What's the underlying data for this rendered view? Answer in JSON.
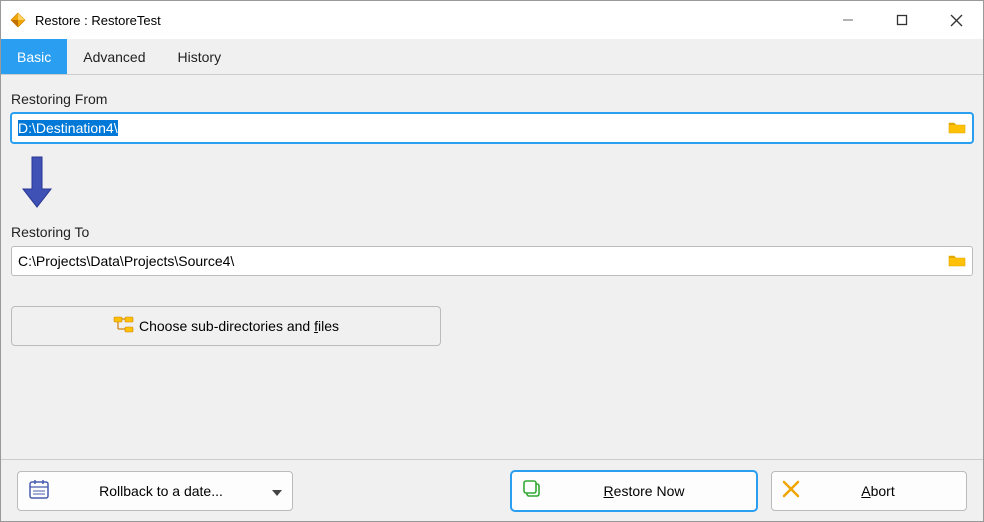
{
  "title": "Restore : RestoreTest",
  "tabs": [
    "Basic",
    "Advanced",
    "History"
  ],
  "restoring_from_label": "Restoring From",
  "restoring_from_value": "D:\\Destination4\\",
  "restoring_to_label": "Restoring To",
  "restoring_to_value": "C:\\Projects\\Data\\Projects\\Source4\\",
  "choose_label": "Choose sub-directories and files",
  "rollback_label": "Rollback to a date...",
  "restore_label": "Restore Now",
  "abort_label": "Abort"
}
